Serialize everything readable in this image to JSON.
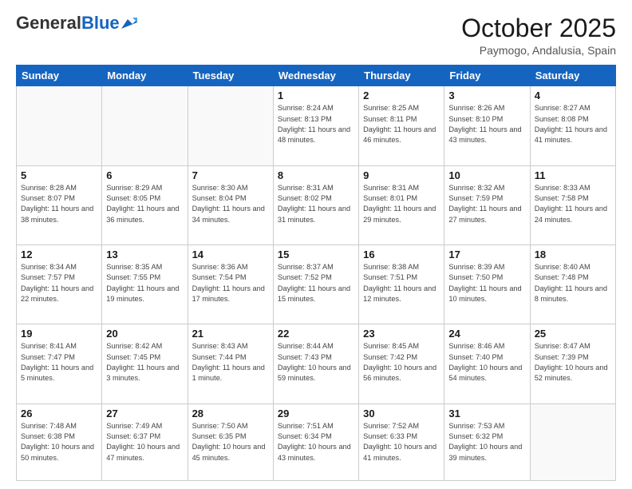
{
  "header": {
    "logo": {
      "general": "General",
      "blue": "Blue"
    },
    "title": "October 2025",
    "location": "Paymogo, Andalusia, Spain"
  },
  "weekdays": [
    "Sunday",
    "Monday",
    "Tuesday",
    "Wednesday",
    "Thursday",
    "Friday",
    "Saturday"
  ],
  "weeks": [
    [
      {
        "day": "",
        "info": ""
      },
      {
        "day": "",
        "info": ""
      },
      {
        "day": "",
        "info": ""
      },
      {
        "day": "1",
        "info": "Sunrise: 8:24 AM\nSunset: 8:13 PM\nDaylight: 11 hours\nand 48 minutes."
      },
      {
        "day": "2",
        "info": "Sunrise: 8:25 AM\nSunset: 8:11 PM\nDaylight: 11 hours\nand 46 minutes."
      },
      {
        "day": "3",
        "info": "Sunrise: 8:26 AM\nSunset: 8:10 PM\nDaylight: 11 hours\nand 43 minutes."
      },
      {
        "day": "4",
        "info": "Sunrise: 8:27 AM\nSunset: 8:08 PM\nDaylight: 11 hours\nand 41 minutes."
      }
    ],
    [
      {
        "day": "5",
        "info": "Sunrise: 8:28 AM\nSunset: 8:07 PM\nDaylight: 11 hours\nand 38 minutes."
      },
      {
        "day": "6",
        "info": "Sunrise: 8:29 AM\nSunset: 8:05 PM\nDaylight: 11 hours\nand 36 minutes."
      },
      {
        "day": "7",
        "info": "Sunrise: 8:30 AM\nSunset: 8:04 PM\nDaylight: 11 hours\nand 34 minutes."
      },
      {
        "day": "8",
        "info": "Sunrise: 8:31 AM\nSunset: 8:02 PM\nDaylight: 11 hours\nand 31 minutes."
      },
      {
        "day": "9",
        "info": "Sunrise: 8:31 AM\nSunset: 8:01 PM\nDaylight: 11 hours\nand 29 minutes."
      },
      {
        "day": "10",
        "info": "Sunrise: 8:32 AM\nSunset: 7:59 PM\nDaylight: 11 hours\nand 27 minutes."
      },
      {
        "day": "11",
        "info": "Sunrise: 8:33 AM\nSunset: 7:58 PM\nDaylight: 11 hours\nand 24 minutes."
      }
    ],
    [
      {
        "day": "12",
        "info": "Sunrise: 8:34 AM\nSunset: 7:57 PM\nDaylight: 11 hours\nand 22 minutes."
      },
      {
        "day": "13",
        "info": "Sunrise: 8:35 AM\nSunset: 7:55 PM\nDaylight: 11 hours\nand 19 minutes."
      },
      {
        "day": "14",
        "info": "Sunrise: 8:36 AM\nSunset: 7:54 PM\nDaylight: 11 hours\nand 17 minutes."
      },
      {
        "day": "15",
        "info": "Sunrise: 8:37 AM\nSunset: 7:52 PM\nDaylight: 11 hours\nand 15 minutes."
      },
      {
        "day": "16",
        "info": "Sunrise: 8:38 AM\nSunset: 7:51 PM\nDaylight: 11 hours\nand 12 minutes."
      },
      {
        "day": "17",
        "info": "Sunrise: 8:39 AM\nSunset: 7:50 PM\nDaylight: 11 hours\nand 10 minutes."
      },
      {
        "day": "18",
        "info": "Sunrise: 8:40 AM\nSunset: 7:48 PM\nDaylight: 11 hours\nand 8 minutes."
      }
    ],
    [
      {
        "day": "19",
        "info": "Sunrise: 8:41 AM\nSunset: 7:47 PM\nDaylight: 11 hours\nand 5 minutes."
      },
      {
        "day": "20",
        "info": "Sunrise: 8:42 AM\nSunset: 7:45 PM\nDaylight: 11 hours\nand 3 minutes."
      },
      {
        "day": "21",
        "info": "Sunrise: 8:43 AM\nSunset: 7:44 PM\nDaylight: 11 hours\nand 1 minute."
      },
      {
        "day": "22",
        "info": "Sunrise: 8:44 AM\nSunset: 7:43 PM\nDaylight: 10 hours\nand 59 minutes."
      },
      {
        "day": "23",
        "info": "Sunrise: 8:45 AM\nSunset: 7:42 PM\nDaylight: 10 hours\nand 56 minutes."
      },
      {
        "day": "24",
        "info": "Sunrise: 8:46 AM\nSunset: 7:40 PM\nDaylight: 10 hours\nand 54 minutes."
      },
      {
        "day": "25",
        "info": "Sunrise: 8:47 AM\nSunset: 7:39 PM\nDaylight: 10 hours\nand 52 minutes."
      }
    ],
    [
      {
        "day": "26",
        "info": "Sunrise: 7:48 AM\nSunset: 6:38 PM\nDaylight: 10 hours\nand 50 minutes."
      },
      {
        "day": "27",
        "info": "Sunrise: 7:49 AM\nSunset: 6:37 PM\nDaylight: 10 hours\nand 47 minutes."
      },
      {
        "day": "28",
        "info": "Sunrise: 7:50 AM\nSunset: 6:35 PM\nDaylight: 10 hours\nand 45 minutes."
      },
      {
        "day": "29",
        "info": "Sunrise: 7:51 AM\nSunset: 6:34 PM\nDaylight: 10 hours\nand 43 minutes."
      },
      {
        "day": "30",
        "info": "Sunrise: 7:52 AM\nSunset: 6:33 PM\nDaylight: 10 hours\nand 41 minutes."
      },
      {
        "day": "31",
        "info": "Sunrise: 7:53 AM\nSunset: 6:32 PM\nDaylight: 10 hours\nand 39 minutes."
      },
      {
        "day": "",
        "info": ""
      }
    ]
  ]
}
